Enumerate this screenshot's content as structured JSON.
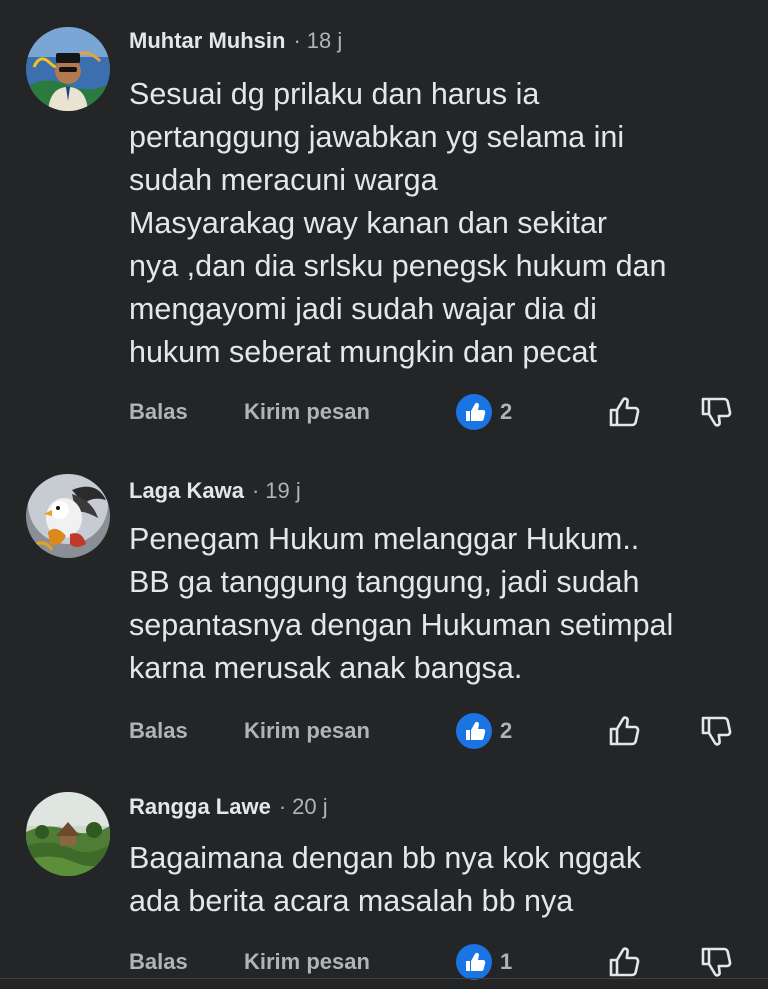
{
  "actions": {
    "reply_label": "Balas",
    "message_label": "Kirim pesan"
  },
  "comments": [
    {
      "author": "Muhtar Muhsin",
      "separator": "·",
      "time": "18 j",
      "text": "Sesuai dg prilaku dan harus ia\npertanggung jawabkan yg selama ini\nsudah meracuni warga\nMasyarakag way kanan dan sekitar\nnya ,dan dia srlsku penegsk hukum dan\nmengayomi jadi sudah wajar dia di\nhukum seberat mungkin dan pecat",
      "like_count": "2"
    },
    {
      "author": "Laga Kawa",
      "separator": "·",
      "time": "19 j",
      "text": "Penegam Hukum melanggar Hukum..\nBB ga tanggung tanggung, jadi sudah\nsepantasnya dengan Hukuman setimpal\nkarna merusak anak bangsa.",
      "like_count": "2"
    },
    {
      "author": "Rangga Lawe",
      "separator": "·",
      "time": "20 j",
      "text": "Bagaimana dengan bb nya kok nggak\nada berita acara masalah bb nya",
      "like_count": "1"
    }
  ],
  "icons": {
    "like_badge": "thumbs-up-icon",
    "upvote": "thumbs-up-outline-icon",
    "downvote": "thumbs-down-outline-icon"
  },
  "colors": {
    "background": "#242526",
    "primary_text": "#e4e6eb",
    "secondary_text": "#b0b3b8",
    "like_blue": "#1b74e4"
  }
}
